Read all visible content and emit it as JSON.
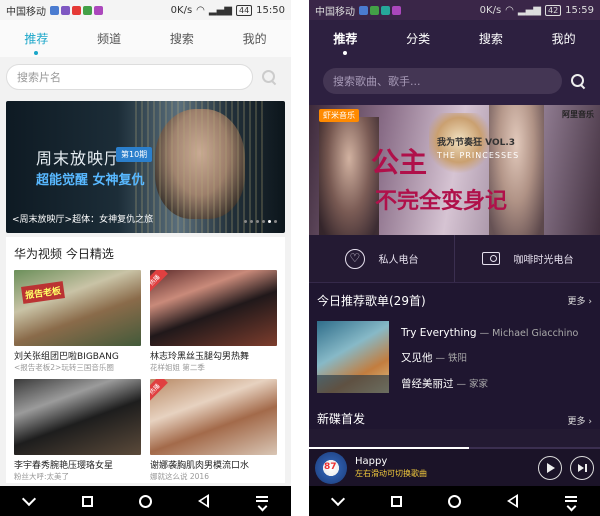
{
  "left": {
    "status": {
      "carrier": "中国移动",
      "speed": "0K/s",
      "battery": "44",
      "time": "15:50",
      "badge_icon_colors": [
        "#4a7bd0",
        "#7e57c2",
        "#e53935",
        "#43a047",
        "#ab47bc"
      ]
    },
    "tabs": [
      {
        "label": "推荐",
        "active": true
      },
      {
        "label": "频道",
        "active": false
      },
      {
        "label": "搜索",
        "active": false
      },
      {
        "label": "我的",
        "active": false
      }
    ],
    "search": {
      "placeholder": "搜索片名"
    },
    "banner": {
      "show": "周末放映厅",
      "episode": "第10期",
      "subtitle": "超能觉醒 女神复仇",
      "caption": "<周末放映厅>超体：女神复仇之旅"
    },
    "section": {
      "title": "华为视频 今日精选",
      "items": [
        {
          "name": "刘关张组团巴啦BIGBANG",
          "meta": "<报告老板2>玩转三国音乐圈",
          "stamp": "报告老板",
          "corner": ""
        },
        {
          "name": "林志玲黑丝玉腿勾男热舞",
          "meta": "花样姐姐 第二季",
          "stamp": "",
          "corner": "热播"
        },
        {
          "name": "李宇春秀腕艳压璎珞女星",
          "meta": "粉丝大呼:太美了",
          "stamp": "",
          "corner": ""
        },
        {
          "name": "谢娜袭胸肌肉男模流口水",
          "meta": "娜就这么说 2016",
          "stamp": "",
          "corner": "热播"
        }
      ]
    }
  },
  "right": {
    "status": {
      "carrier": "中国移动",
      "speed": "0K/s",
      "battery": "42",
      "time": "15:59",
      "badge_icon_colors": [
        "#4a7bd0",
        "#43a047",
        "#26a69a",
        "#ab47bc"
      ]
    },
    "tabs": [
      {
        "label": "推荐",
        "active": true
      },
      {
        "label": "分类",
        "active": false
      },
      {
        "label": "搜索",
        "active": false
      },
      {
        "label": "我的",
        "active": false
      }
    ],
    "search": {
      "placeholder": "搜索歌曲、歌手..."
    },
    "banner": {
      "xiami": "虾米音乐",
      "alibaba": "阿里音乐",
      "big1": "公主",
      "vol": "我为节奏狂 VOL.3",
      "princess": "THE PRINCESSES",
      "big2": "不完全变身记"
    },
    "radios": [
      {
        "label": "私人电台",
        "icon": "heart-icon"
      },
      {
        "label": "咖啡时光电台",
        "icon": "radio-icon"
      }
    ],
    "recommend": {
      "title": "今日推荐歌单(29首)",
      "more": "更多 ›",
      "songs": [
        {
          "title": "Try Everything",
          "artist": "— Michael Giacchino"
        },
        {
          "title": "又见他",
          "artist": "— 铁阳"
        },
        {
          "title": "曾经美丽过",
          "artist": "— 家家"
        }
      ]
    },
    "new_albums": {
      "title": "新碟首发",
      "more": "更多 ›"
    },
    "player": {
      "title": "Happy",
      "hint": "左右滑动可切换歌曲",
      "progress": 0.55
    }
  }
}
